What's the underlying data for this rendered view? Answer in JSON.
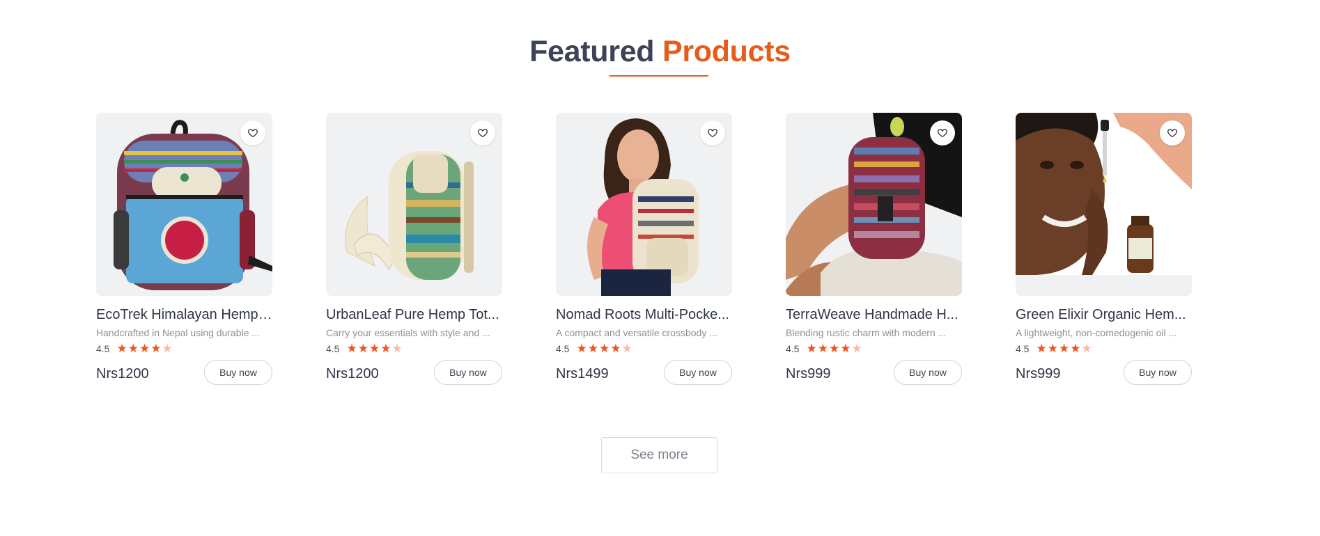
{
  "section": {
    "title_main": "Featured",
    "title_accent": "Products"
  },
  "colors": {
    "accent": "#e45d1b",
    "star": "#f4511e",
    "star_faint": "#f9b9a4"
  },
  "products": [
    {
      "name": "EcoTrek Himalayan Hemp ...",
      "description": "Handcrafted in Nepal using durable ...",
      "rating": "4.5",
      "price": "Nrs1200",
      "buy_label": "Buy now",
      "image_icon": "striped-hemp-backpack-image"
    },
    {
      "name": "UrbanLeaf Pure Hemp Tot...",
      "description": "Carry your essentials with style and ...",
      "rating": "4.5",
      "price": "Nrs1200",
      "buy_label": "Buy now",
      "image_icon": "hemp-backpack-side-image"
    },
    {
      "name": "Nomad Roots Multi-Pocke...",
      "description": "A compact and versatile crossbody ...",
      "rating": "4.5",
      "price": "Nrs1499",
      "buy_label": "Buy now",
      "image_icon": "woman-with-backpack-image"
    },
    {
      "name": "TerraWeave Handmade H...",
      "description": "Blending rustic charm with modern ...",
      "rating": "4.5",
      "price": "Nrs999",
      "buy_label": "Buy now",
      "image_icon": "person-with-backpack-image"
    },
    {
      "name": "Green Elixir Organic Hem...",
      "description": "A lightweight, non-comedogenic oil ...",
      "rating": "4.5",
      "price": "Nrs999",
      "buy_label": "Buy now",
      "image_icon": "woman-with-oil-dropper-image"
    }
  ],
  "rating_stars": {
    "full": 4,
    "faint": 1
  },
  "see_more_label": "See more"
}
